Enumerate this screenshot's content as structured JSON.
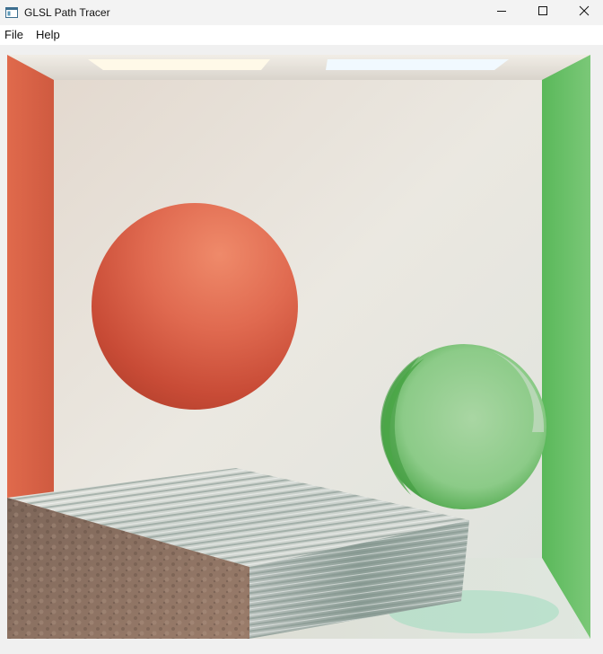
{
  "window": {
    "title": "GLSL Path Tracer",
    "app_icon": "app-window-icon",
    "controls": {
      "minimize_icon": "minimize-icon",
      "maximize_icon": "maximize-icon",
      "close_icon": "close-icon"
    }
  },
  "menu": {
    "items": [
      {
        "label": "File"
      },
      {
        "label": "Help"
      }
    ]
  },
  "scene": {
    "description_objects": [
      "red-wall",
      "green-wall",
      "back-wall",
      "ceiling",
      "floor",
      "ceiling-light-left",
      "ceiling-light-right",
      "red-sphere",
      "glass-sphere",
      "box"
    ],
    "colors": {
      "red_wall": "#d9654a",
      "green_wall": "#6ec36a",
      "back_wall": "#e6e3dc",
      "ceiling": "#ece8e1",
      "floor": "#e2e4df",
      "red_sphere": "#d9624a",
      "glass_sphere": "#7fc58a",
      "light_warm": "#fff8e6",
      "light_cool": "#eef8ff",
      "box_top": "#d9dbd6",
      "box_front_right": "#9aa9a3",
      "box_front_left": "#8b6f5e"
    }
  }
}
